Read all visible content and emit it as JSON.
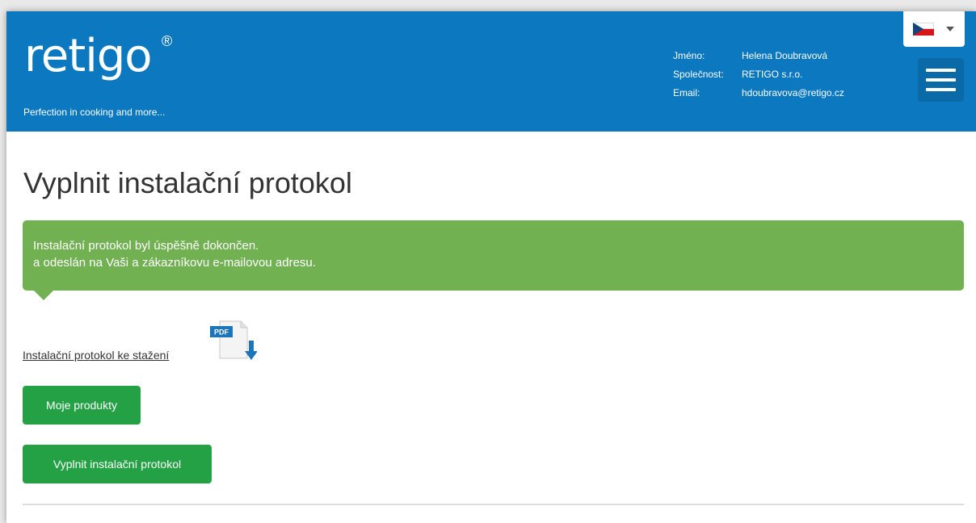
{
  "header": {
    "logo_text": "retigo",
    "logo_mark": "®",
    "tagline": "Perfection in cooking and more...",
    "user": {
      "name_label": "Jméno:",
      "name_value": "Helena Doubravová",
      "company_label": "Společnost:",
      "company_value": "RETIGO s.r.o.",
      "email_label": "Email:",
      "email_value": "hdoubravova@retigo.cz"
    },
    "language": {
      "flag_icon": "czech-flag-icon"
    },
    "menu_icon": "hamburger-menu-icon",
    "bg_color": "#0b78bf"
  },
  "main": {
    "title": "Vyplnit instalační protokol",
    "alert": {
      "line1": "Instalační protokol byl úspěšně dokončen.",
      "line2": "a odeslán na Vaši a zákazníkovu e-mailovou adresu.",
      "color": "#71b152"
    },
    "download": {
      "link_text": "Instalační protokol ke stažení",
      "pdf_badge": "PDF",
      "icon": "pdf-download-icon"
    },
    "buttons": {
      "products_label": "Moje produkty",
      "fill_label": "Vyplnit instalační protokol",
      "color": "#24a145"
    }
  }
}
